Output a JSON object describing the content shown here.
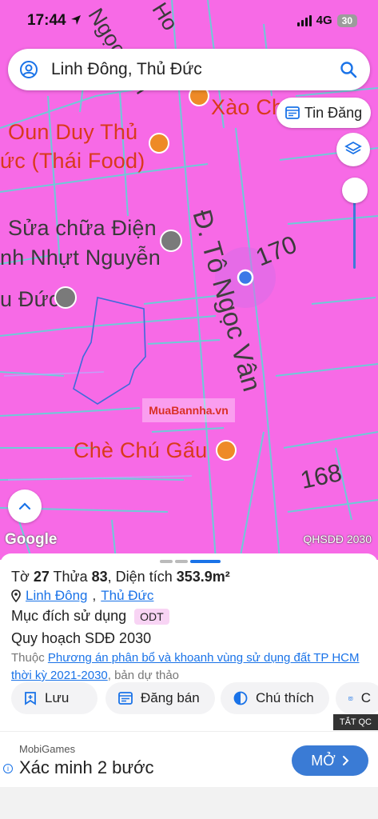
{
  "status_bar": {
    "time": "17:44",
    "network": "4G",
    "battery": "30"
  },
  "search": {
    "query": "Linh Đông, Thủ Đức"
  },
  "map": {
    "buttons": {
      "post_listing": "Tin Đăng"
    },
    "pois": [
      {
        "label_line1": "Oun Duy Thủ",
        "label_line2": "ức (Thái Food)"
      },
      {
        "label_line1": "Sửa chữa Điện",
        "label_line2": "nh Nhựt Nguyễn"
      },
      {
        "label": "u Đức"
      },
      {
        "label": "Xào Ch"
      },
      {
        "label": "Chè Chú Gấu"
      }
    ],
    "street_partial_top": "Ngọc Vân",
    "street_partial_top2": "Ho",
    "street_name": "Đ. Tô Ngọc Vân",
    "parcel_numbers": [
      "170",
      "168"
    ],
    "google_logo": "Google",
    "layer_label": "QHSDĐ 2030",
    "watermark": "MuaBannha.vn"
  },
  "sheet": {
    "title_prefix": "Tờ",
    "sheet_no": "27",
    "plot_prefix": "Thửa",
    "plot_no": "83",
    "area_text": ", Diện tích",
    "area_value": "353.9m²",
    "ward": "Linh Đông",
    "district": "Thủ Đức",
    "purpose_label": "Mục đích sử dụng",
    "purpose_code": "ODT",
    "plan_label": "Quy hoạch SDĐ 2030",
    "source_prefix": "Thuộc",
    "source_link": "Phương án phân bổ và khoanh vùng sử dụng đất TP HCM thời kỳ 2021-2030",
    "source_suffix": ", bản dự thảo",
    "actions": {
      "save": "Lưu",
      "post_sale": "Đăng bán",
      "legend": "Chú thích",
      "more": "C"
    }
  },
  "ad": {
    "close_label": "TẮT QC",
    "brand": "MobiGames",
    "title": "Xác minh 2 bước",
    "cta": "MỞ"
  },
  "colors": {
    "map_fill": "#f76ae6",
    "accent": "#1a73e8",
    "cta": "#3a7bd5"
  }
}
